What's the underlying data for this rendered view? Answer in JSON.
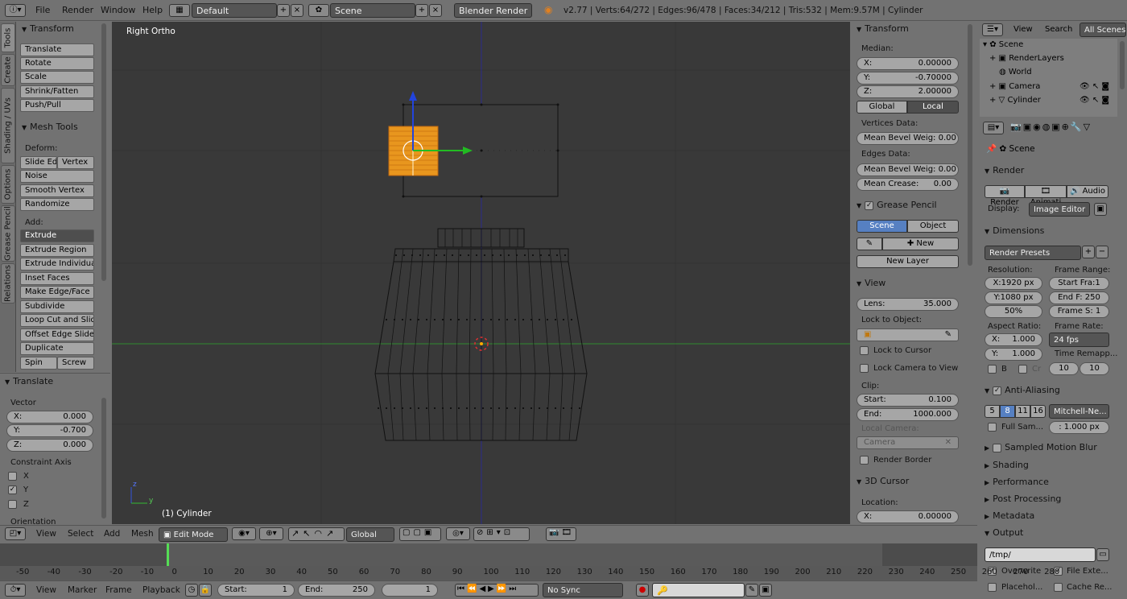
{
  "topbar": {
    "menus": [
      "File",
      "Render",
      "Window",
      "Help"
    ],
    "layout": "Default",
    "scene": "Scene",
    "engine": "Blender Render",
    "info": "v2.77 | Verts:64/272 | Edges:96/478 | Faces:34/212 | Tris:532 | Mem:9.57M | Cylinder"
  },
  "tabs": [
    "Tools",
    "Create",
    "Shading / UVs",
    "Options",
    "Grease Pencil",
    "Relations"
  ],
  "tools": {
    "transform_header": "Transform",
    "transform": [
      "Translate",
      "Rotate",
      "Scale",
      "Shrink/Fatten",
      "Push/Pull"
    ],
    "mesh_header": "Mesh Tools",
    "deform_label": "Deform:",
    "deform": [
      [
        "Slide Ed",
        "Vertex"
      ],
      [
        "Noise"
      ],
      [
        "Smooth Vertex"
      ],
      [
        "Randomize"
      ]
    ],
    "add_label": "Add:",
    "add": [
      "Extrude",
      "Extrude Region",
      "Extrude Individual",
      "Inset Faces",
      "Make Edge/Face",
      "Subdivide",
      "Loop Cut and Slide",
      "Offset Edge Slide",
      "Duplicate"
    ],
    "spin": [
      "Spin",
      "Screw"
    ]
  },
  "operator": {
    "header": "Translate",
    "vector_label": "Vector",
    "fields": [
      {
        "label": "X:",
        "value": "0.000"
      },
      {
        "label": "Y:",
        "value": "-0.700"
      },
      {
        "label": "Z:",
        "value": "0.000"
      }
    ],
    "constraint_label": "Constraint Axis",
    "axes": [
      {
        "label": "X",
        "checked": false
      },
      {
        "label": "Y",
        "checked": true
      },
      {
        "label": "Z",
        "checked": false
      }
    ],
    "orientation_label": "Orientation"
  },
  "viewport": {
    "view_name": "Right Ortho",
    "object_label": "(1) Cylinder",
    "axis_z": "z",
    "axis_y": "y"
  },
  "npanel": {
    "transform_header": "Transform",
    "median_label": "Median:",
    "median": [
      {
        "label": "X:",
        "value": "0.00000"
      },
      {
        "label": "Y:",
        "value": "-0.70000"
      },
      {
        "label": "Z:",
        "value": "2.00000"
      }
    ],
    "global": "Global",
    "local": "Local",
    "vertices_label": "Vertices Data:",
    "bevel_weight": "Mean Bevel Weig: 0.00",
    "edges_label": "Edges Data:",
    "edge_bevel": "Mean Bevel Weig: 0.00",
    "crease_label": "Mean Crease:",
    "crease_value": "0.00",
    "gp_header": "Grease Pencil",
    "gp_scene": "Scene",
    "gp_object": "Object",
    "gp_new": "New",
    "gp_new_layer": "New Layer",
    "view_header": "View",
    "lens_label": "Lens:",
    "lens_value": "35.000",
    "lock_label": "Lock to Object:",
    "lock_cursor": "Lock to Cursor",
    "lock_camera": "Lock Camera to View",
    "clip_label": "Clip:",
    "clip_start_label": "Start:",
    "clip_start": "0.100",
    "clip_end_label": "End:",
    "clip_end": "1000.000",
    "local_camera_label": "Local Camera:",
    "camera": "Camera",
    "render_border": "Render Border",
    "cursor_header": "3D Cursor",
    "location_label": "Location:",
    "cursor_x_label": "X:",
    "cursor_x": "0.00000"
  },
  "outliner": {
    "view": "View",
    "search": "Search",
    "all_scenes": "All Scenes",
    "items": [
      "Scene",
      "RenderLayers",
      "World",
      "Camera",
      "Cylinder"
    ]
  },
  "props": {
    "scene": "Scene",
    "render_header": "Render",
    "render_btns": [
      "Render",
      "Animati",
      "Audio"
    ],
    "display_label": "Display:",
    "display_value": "Image Editor",
    "dimensions_header": "Dimensions",
    "presets": "Render Presets",
    "resolution_label": "Resolution:",
    "frame_range_label": "Frame Range:",
    "res_x": "X:1920 px",
    "res_y": "Y:1080 px",
    "res_pct": "50%",
    "start_frame": "Start Fra:1",
    "end_frame": "End F: 250",
    "frame_step": "Frame S: 1",
    "aspect_label": "Aspect Ratio:",
    "frame_rate_label": "Frame Rate:",
    "aspect_x_label": "X:",
    "aspect_x": "1.000",
    "aspect_y_label": "Y:",
    "aspect_y": "1.000",
    "fps": "24 fps",
    "time_remap": "Time Remapp...",
    "b": "B",
    "cr": "Cr",
    "remap_old": "10",
    "remap_new": "10",
    "aa_header": "Anti-Aliasing",
    "aa_samples": [
      "5",
      "8",
      "11",
      "16"
    ],
    "aa_filter": "Mitchell-Ne...",
    "full_sample": "Full Sam...",
    "filter_size": ": 1.000 px",
    "motion_blur": "Sampled Motion Blur",
    "shading": "Shading",
    "performance": "Performance",
    "post_processing": "Post Processing",
    "metadata": "Metadata",
    "output_header": "Output",
    "output_path": "/tmp/",
    "overwrite": "Overwrite",
    "file_ext": "File Exte...",
    "placeholders": "Placehol...",
    "cache": "Cache Re..."
  },
  "viewheader": {
    "menus": [
      "View",
      "Select",
      "Add",
      "Mesh"
    ],
    "mode": "Edit Mode",
    "orientation": "Global"
  },
  "timeline": {
    "ticks": [
      "-50",
      "-40",
      "-30",
      "-20",
      "-10",
      "0",
      "10",
      "20",
      "30",
      "40",
      "50",
      "60",
      "70",
      "80",
      "90",
      "100",
      "110",
      "120",
      "130",
      "140",
      "150",
      "160",
      "170",
      "180",
      "190",
      "200",
      "210",
      "220",
      "230",
      "240",
      "250",
      "260",
      "270",
      "280"
    ],
    "menus": [
      "View",
      "Marker",
      "Frame",
      "Playback"
    ],
    "start_label": "Start:",
    "start": "1",
    "end_label": "End:",
    "end": "250",
    "current": "1",
    "sync": "No Sync"
  }
}
